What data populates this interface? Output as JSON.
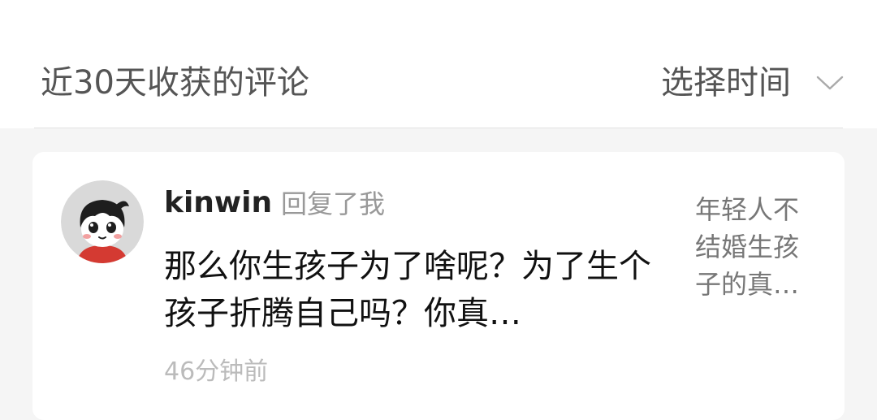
{
  "header": {
    "title": "近30天收获的评论",
    "time_picker_label": "选择时间",
    "time_picker_icon": "chevron-down-icon"
  },
  "comment": {
    "avatar_icon": "cartoon-boy-avatar",
    "username": "kinwin",
    "reply_hint": "回复了我",
    "text": "那么你生孩子为了啥呢？为了生个孩子折腾自己吗？你真…",
    "time_ago": "46分钟前",
    "article_preview": "年轻人不结婚生孩子的真…"
  },
  "colors": {
    "page_background": "#f5f5f5",
    "card_background": "#ffffff",
    "avatar_background": "#d9d9d9",
    "secondary_text": "#999999"
  }
}
